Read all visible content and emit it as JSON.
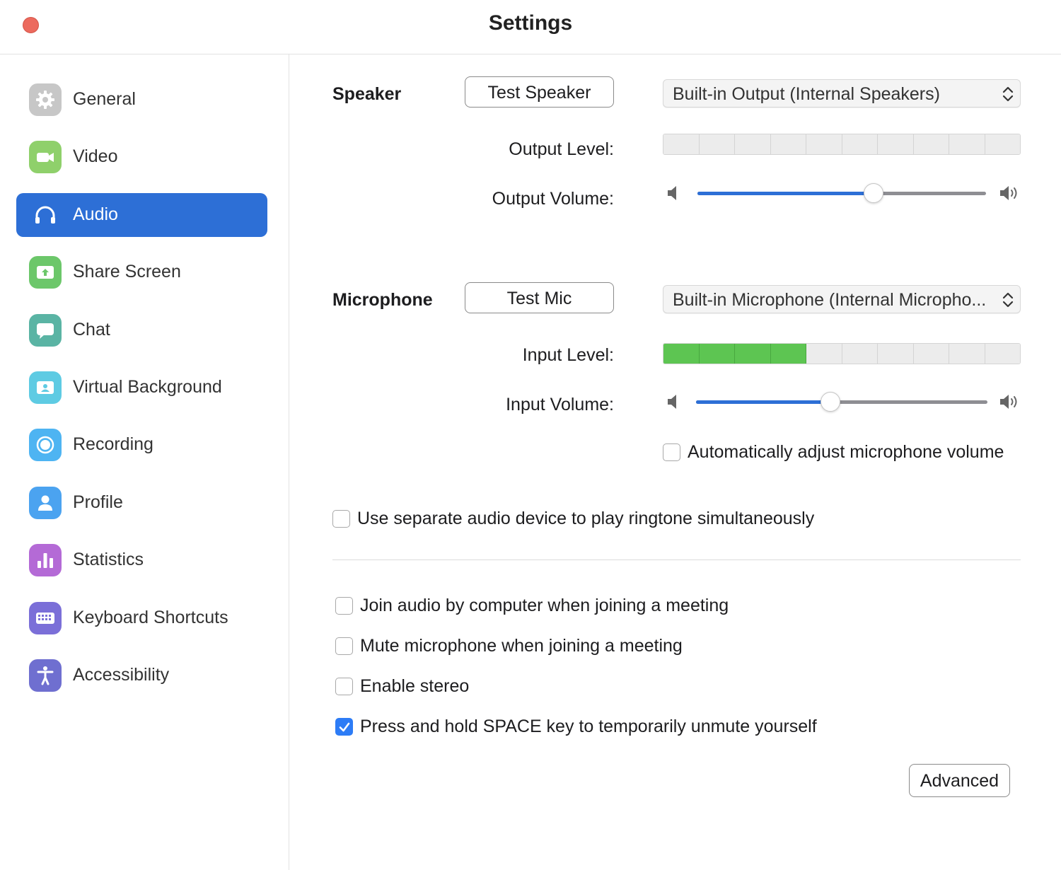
{
  "window": {
    "title": "Settings"
  },
  "sidebar": {
    "items": [
      {
        "label": "General",
        "icon": "gear-icon",
        "color": "#c7c7c7"
      },
      {
        "label": "Video",
        "icon": "video-camera-icon",
        "color": "#8fd06b"
      },
      {
        "label": "Audio",
        "icon": "headphones-icon",
        "color": "#2d6fd6",
        "active": true
      },
      {
        "label": "Share Screen",
        "icon": "share-screen-icon",
        "color": "#6cc76a"
      },
      {
        "label": "Chat",
        "icon": "chat-bubble-icon",
        "color": "#5ab4a4"
      },
      {
        "label": "Virtual Background",
        "icon": "virtual-background-icon",
        "color": "#5ecbe3"
      },
      {
        "label": "Recording",
        "icon": "recording-icon",
        "color": "#4eb4f2"
      },
      {
        "label": "Profile",
        "icon": "profile-icon",
        "color": "#4ba3f0"
      },
      {
        "label": "Statistics",
        "icon": "statistics-icon",
        "color": "#b46ad6"
      },
      {
        "label": "Keyboard Shortcuts",
        "icon": "keyboard-icon",
        "color": "#7b6fd8"
      },
      {
        "label": "Accessibility",
        "icon": "accessibility-icon",
        "color": "#6f6fd0"
      }
    ]
  },
  "speaker": {
    "section_label": "Speaker",
    "test_button": "Test Speaker",
    "device": "Built-in Output (Internal Speakers)",
    "output_level_label": "Output Level:",
    "output_level_active_segments": 0,
    "output_volume_label": "Output Volume:",
    "output_volume": 0.61
  },
  "microphone": {
    "section_label": "Microphone",
    "test_button": "Test Mic",
    "device": "Built-in Microphone (Internal Micropho...",
    "input_level_label": "Input Level:",
    "input_level_active_segments": 4,
    "input_volume_label": "Input Volume:",
    "input_volume": 0.46,
    "auto_adjust_label": "Automatically adjust microphone volume",
    "auto_adjust_checked": false
  },
  "options": {
    "separate_ringtone_label": "Use separate audio device to play ringtone simultaneously",
    "separate_ringtone_checked": false,
    "items": [
      {
        "label": "Join audio by computer when joining a meeting",
        "checked": false
      },
      {
        "label": "Mute microphone when joining a meeting",
        "checked": false
      },
      {
        "label": "Enable stereo",
        "checked": false
      },
      {
        "label": "Press and hold SPACE key to temporarily unmute yourself",
        "checked": true
      }
    ]
  },
  "advanced_button": "Advanced",
  "meter_segments": 10,
  "colors": {
    "accent": "#2d6fd6",
    "level_on": "#5dc552",
    "checkbox_checked": "#2d7cf6"
  }
}
